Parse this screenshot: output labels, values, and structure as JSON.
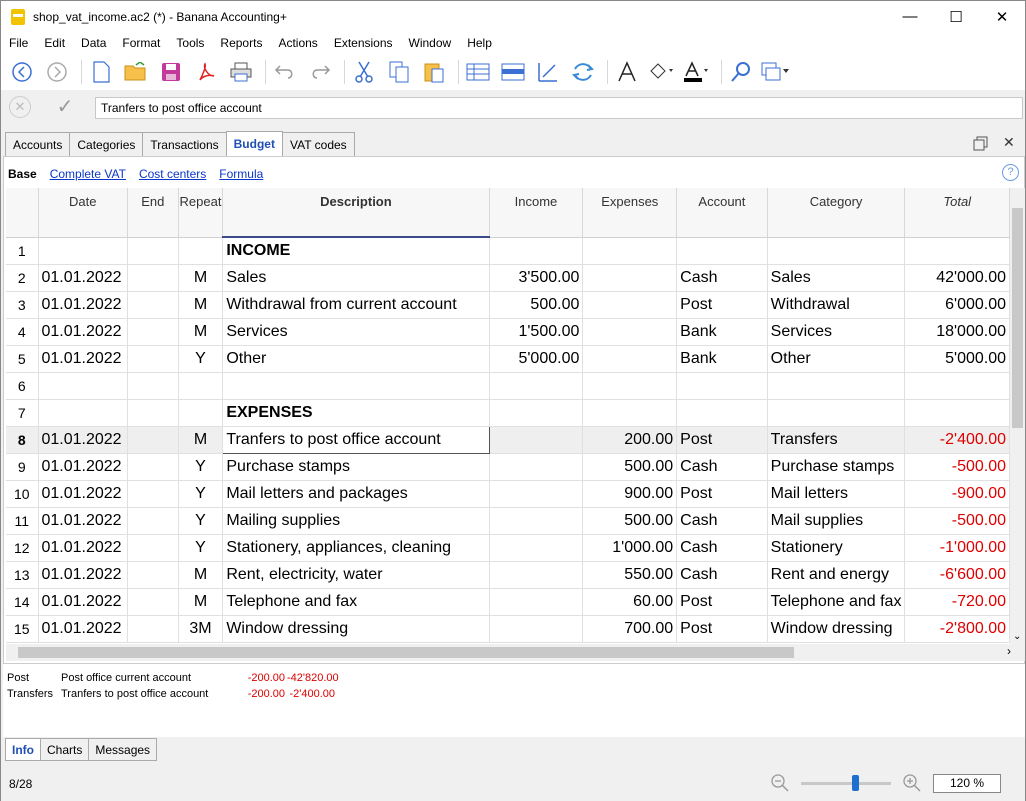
{
  "window": {
    "title": "shop_vat_income.ac2 (*) - Banana Accounting+",
    "minimize": "—",
    "maximize": "☐",
    "close": "✕"
  },
  "menu": [
    "File",
    "Edit",
    "Data",
    "Format",
    "Tools",
    "Reports",
    "Actions",
    "Extensions",
    "Window",
    "Help"
  ],
  "toolbar_icons": [
    "back-icon",
    "forward-icon",
    "new-file-icon",
    "open-folder-icon",
    "save-icon",
    "pdf-icon",
    "print-icon",
    "undo-icon",
    "redo-icon",
    "cut-icon",
    "copy-icon",
    "paste-icon",
    "insert-row-icon",
    "row-options-icon",
    "edit-pen-icon",
    "recheck-icon",
    "font-icon",
    "fill-color-icon",
    "text-color-icon",
    "search-icon",
    "window-options-icon"
  ],
  "editbar": {
    "value": "Tranfers to post office account"
  },
  "tabs": [
    "Accounts",
    "Categories",
    "Transactions",
    "Budget",
    "VAT codes"
  ],
  "active_tab": "Budget",
  "views": {
    "base": "Base",
    "complete_vat": "Complete VAT",
    "cost_centers": "Cost centers",
    "formula": "Formula"
  },
  "help_icon": "?",
  "columns": {
    "date": "Date",
    "end": "End",
    "repeat": "Repeat",
    "description": "Description",
    "income": "Income",
    "expenses": "Expenses",
    "account": "Account",
    "category": "Category",
    "total": "Total"
  },
  "rows": [
    {
      "n": "1",
      "date": "",
      "end": "",
      "repeat": "",
      "desc": "INCOME",
      "income": "",
      "expenses": "",
      "account": "",
      "category": "",
      "total": "",
      "bold": true
    },
    {
      "n": "2",
      "date": "01.01.2022",
      "end": "",
      "repeat": "M",
      "desc": "Sales",
      "income": "3'500.00",
      "expenses": "",
      "account": "Cash",
      "category": "Sales",
      "total": "42'000.00"
    },
    {
      "n": "3",
      "date": "01.01.2022",
      "end": "",
      "repeat": "M",
      "desc": "Withdrawal from current account",
      "income": "500.00",
      "expenses": "",
      "account": "Post",
      "category": "Withdrawal",
      "total": "6'000.00"
    },
    {
      "n": "4",
      "date": "01.01.2022",
      "end": "",
      "repeat": "M",
      "desc": "Services",
      "income": "1'500.00",
      "expenses": "",
      "account": "Bank",
      "category": "Services",
      "total": "18'000.00"
    },
    {
      "n": "5",
      "date": "01.01.2022",
      "end": "",
      "repeat": "Y",
      "desc": "Other",
      "income": "5'000.00",
      "expenses": "",
      "account": "Bank",
      "category": "Other",
      "total": "5'000.00"
    },
    {
      "n": "6",
      "date": "",
      "end": "",
      "repeat": "",
      "desc": "",
      "income": "",
      "expenses": "",
      "account": "",
      "category": "",
      "total": ""
    },
    {
      "n": "7",
      "date": "",
      "end": "",
      "repeat": "",
      "desc": "EXPENSES",
      "income": "",
      "expenses": "",
      "account": "",
      "category": "",
      "total": "",
      "bold": true
    },
    {
      "n": "8",
      "date": "01.01.2022",
      "end": "",
      "repeat": "M",
      "desc": "Tranfers to post office account",
      "income": "",
      "expenses": "200.00",
      "account": "Post",
      "category": "Transfers",
      "total": "-2'400.00",
      "neg": true,
      "sel": true
    },
    {
      "n": "9",
      "date": "01.01.2022",
      "end": "",
      "repeat": "Y",
      "desc": "Purchase stamps",
      "income": "",
      "expenses": "500.00",
      "account": "Cash",
      "category": "Purchase stamps",
      "total": "-500.00",
      "neg": true
    },
    {
      "n": "10",
      "date": "01.01.2022",
      "end": "",
      "repeat": "Y",
      "desc": "Mail letters and packages",
      "income": "",
      "expenses": "900.00",
      "account": "Post",
      "category": "Mail letters",
      "total": "-900.00",
      "neg": true
    },
    {
      "n": "11",
      "date": "01.01.2022",
      "end": "",
      "repeat": "Y",
      "desc": "Mailing supplies",
      "income": "",
      "expenses": "500.00",
      "account": "Cash",
      "category": "Mail supplies",
      "total": "-500.00",
      "neg": true
    },
    {
      "n": "12",
      "date": "01.01.2022",
      "end": "",
      "repeat": "Y",
      "desc": "Stationery, appliances, cleaning",
      "income": "",
      "expenses": "1'000.00",
      "account": "Cash",
      "category": "Stationery",
      "total": "-1'000.00",
      "neg": true
    },
    {
      "n": "13",
      "date": "01.01.2022",
      "end": "",
      "repeat": "M",
      "desc": "Rent, electricity, water",
      "income": "",
      "expenses": "550.00",
      "account": "Cash",
      "category": "Rent and energy",
      "total": "-6'600.00",
      "neg": true
    },
    {
      "n": "14",
      "date": "01.01.2022",
      "end": "",
      "repeat": "M",
      "desc": "Telephone and fax",
      "income": "",
      "expenses": "60.00",
      "account": "Post",
      "category": "Telephone and fax",
      "total": "-720.00",
      "neg": true
    },
    {
      "n": "15",
      "date": "01.01.2022",
      "end": "",
      "repeat": "3M",
      "desc": "Window dressing",
      "income": "",
      "expenses": "700.00",
      "account": "Post",
      "category": "Window dressing",
      "total": "-2'800.00",
      "neg": true
    }
  ],
  "info": [
    {
      "code": "Post",
      "desc": "Post office current account",
      "v1": "-200.00",
      "v2": "-42'820.00"
    },
    {
      "code": "Transfers",
      "desc": "Tranfers to post office account",
      "v1": "-200.00",
      "v2": "-2'400.00"
    }
  ],
  "bottom_tabs": [
    "Info",
    "Charts",
    "Messages"
  ],
  "status": {
    "position": "8/28",
    "zoom": "120 %",
    "zoom_level": 0.6
  },
  "colors": {
    "accent": "#1f4fb4",
    "negative": "#dd0000",
    "link": "#0b37c8"
  }
}
